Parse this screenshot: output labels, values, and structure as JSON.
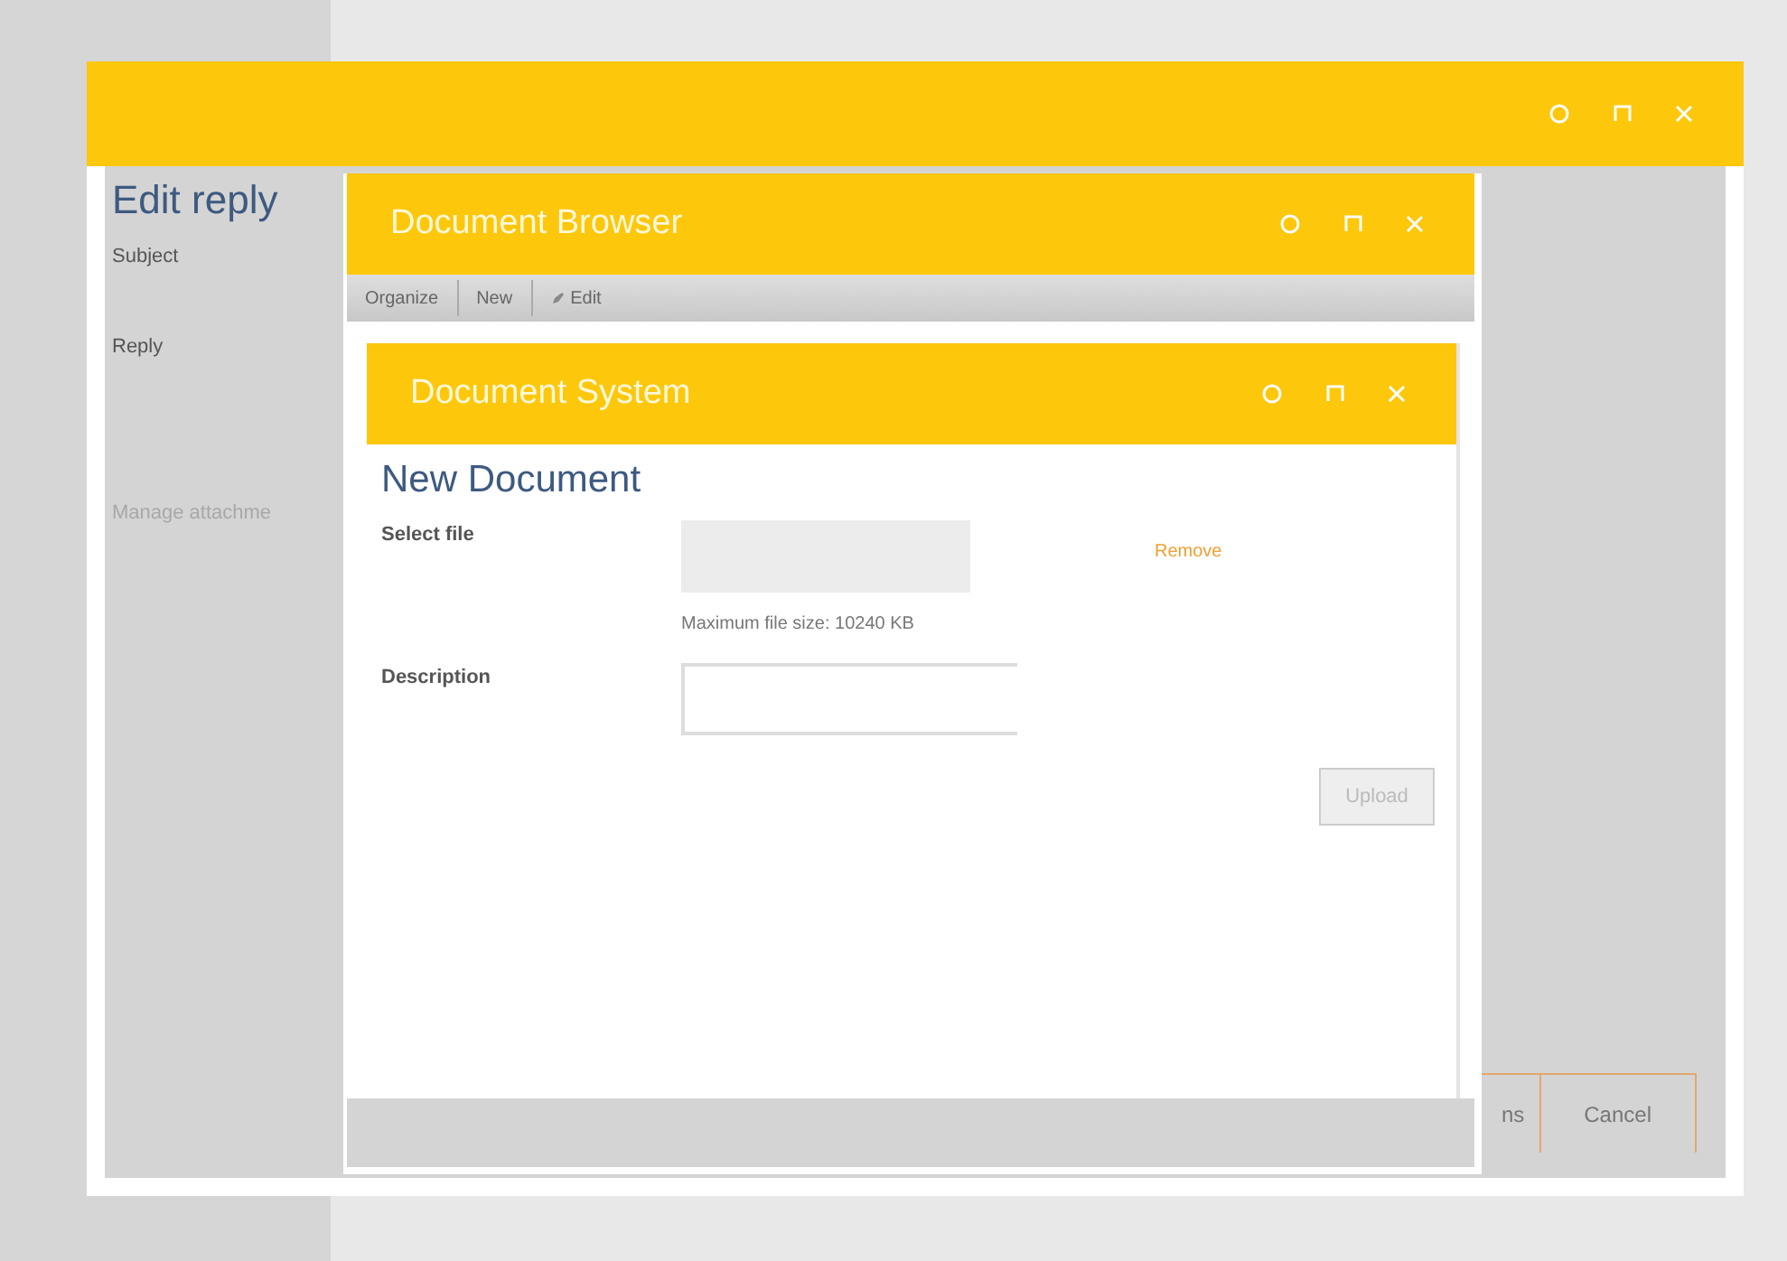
{
  "edit_reply": {
    "title": "Edit reply",
    "fields": [
      {
        "label": "Subject"
      },
      {
        "label": "Reply"
      }
    ],
    "link": {
      "label": "Manage attachme",
      "disabled": true
    }
  },
  "document_browser": {
    "title": "Document Browser",
    "toolbar": [
      {
        "label": "Organize",
        "kind": "text"
      },
      {
        "label": "New",
        "kind": "text"
      },
      {
        "label": "Edit",
        "kind": "edit"
      }
    ]
  },
  "document_system": {
    "title": "Document System",
    "heading": "New Document",
    "select_file": {
      "label": "Select file",
      "remove": "Remove",
      "hint": "Maximum file size: 10240 KB"
    },
    "description": {
      "label": "Description"
    },
    "upload": {
      "label": "Upload",
      "disabled": true
    }
  },
  "footer_buttons": [
    {
      "label": "ns"
    },
    {
      "label": "Cancel"
    }
  ]
}
